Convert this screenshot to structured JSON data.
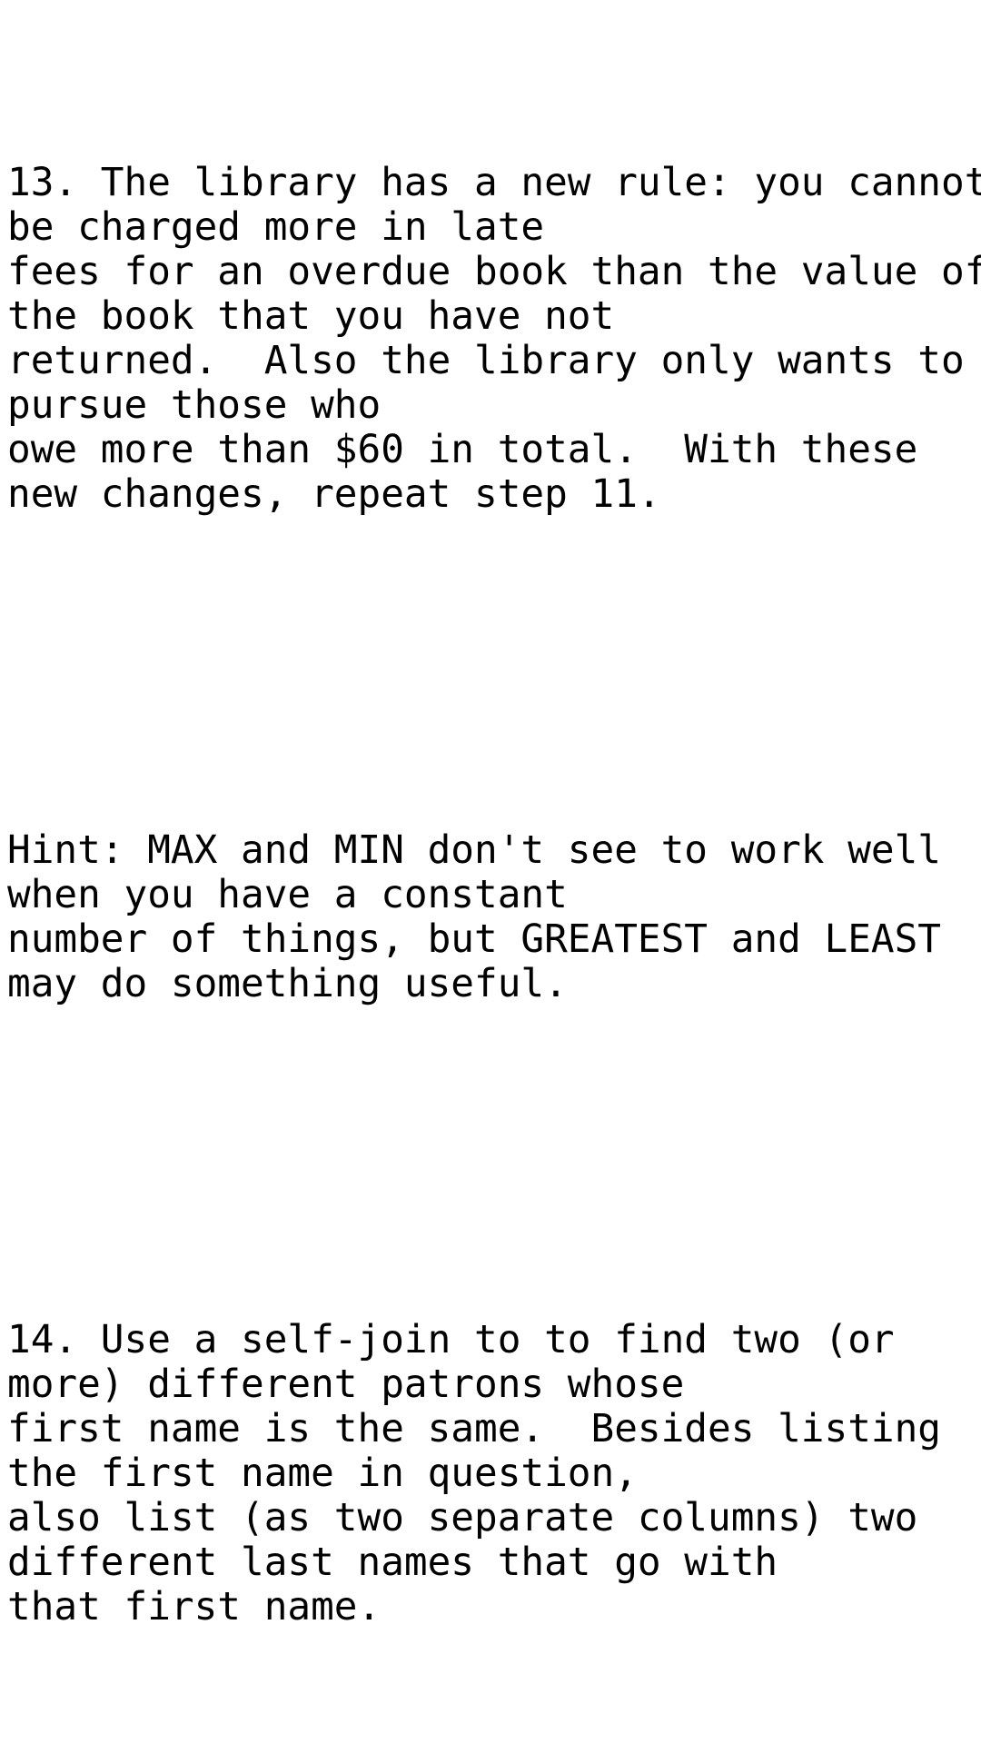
{
  "document": {
    "background_color": "#ffffff",
    "text_color": "#000000",
    "blocks": [
      {
        "id": "question-13",
        "label": "13",
        "text": "13. The library has a new rule: you cannot\nbe charged more in late\nfees for an overdue book than the value of\nthe book that you have not\nreturned.  Also the library only wants to\npursue those who\nowe more than $60 in total.  With these\nnew changes, repeat step 11."
      },
      {
        "id": "hint",
        "label": "Hint",
        "text": "Hint: MAX and MIN don't see to work well\nwhen you have a constant\nnumber of things, but GREATEST and LEAST\nmay do something useful."
      },
      {
        "id": "question-14",
        "label": "14",
        "text": "14. Use a self-join to to find two (or\nmore) different patrons whose\nfirst name is the same.  Besides listing\nthe first name in question,\nalso list (as two separate columns) two\ndifferent last names that go with\nthat first name."
      }
    ]
  }
}
